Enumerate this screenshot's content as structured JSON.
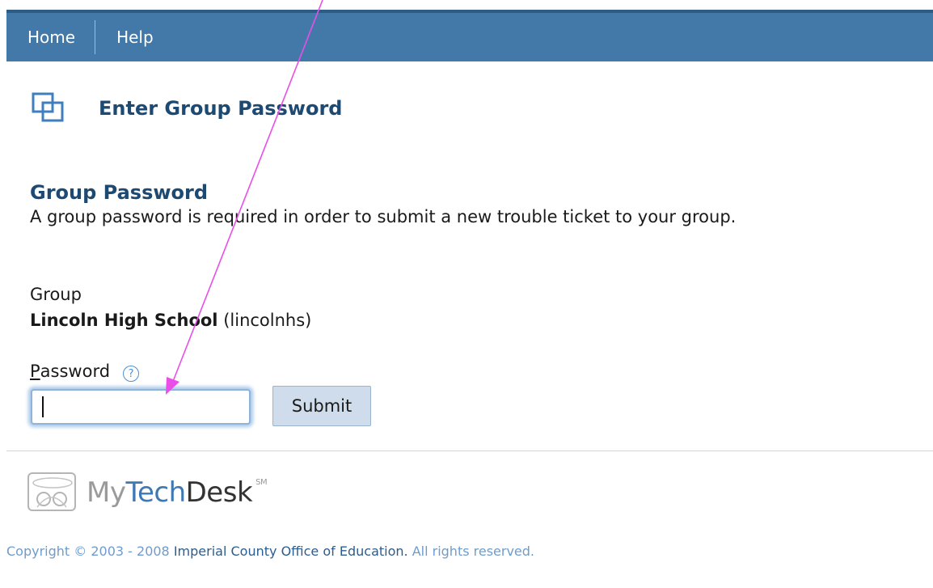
{
  "nav": {
    "home_label": "Home",
    "help_label": "Help"
  },
  "page": {
    "title": "Enter Group Password"
  },
  "section": {
    "heading": "Group Password",
    "description": "A group password is required in order to submit a new trouble ticket to your group."
  },
  "group": {
    "label": "Group",
    "name": "Lincoln High School",
    "code": "(lincolnhs)"
  },
  "password": {
    "label_first": "P",
    "label_rest": "assword",
    "help_glyph": "?",
    "value": ""
  },
  "submit": {
    "label": "Submit"
  },
  "footer": {
    "logo_part1": "My",
    "logo_part2": "Tech",
    "logo_part3": "Desk",
    "logo_mark": "SM",
    "copyright_prefix": "Copyright © 2003 - 2008 ",
    "copyright_org": "Imperial County Office of Education.",
    "copyright_suffix": " All rights reserved."
  },
  "colors": {
    "nav_bar": "#4379a8",
    "heading": "#1d4a73",
    "arrow": "#e94ee9"
  },
  "icons": {
    "title": "group-squares-icon",
    "help": "help-circle-icon",
    "logo": "mytechdesk-logo-icon"
  }
}
